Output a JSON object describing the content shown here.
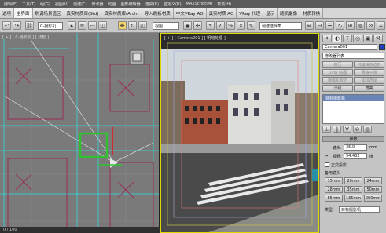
{
  "menubar": {
    "items": [
      "编辑(E)",
      "工具(T)",
      "组(G)",
      "视图(V)",
      "创建(C)",
      "修改器",
      "动画",
      "图形编辑器",
      "渲染(R)",
      "自定义(U)",
      "MAXScript(M)",
      "帮助(H)"
    ]
  },
  "tabs": [
    {
      "label": "选项",
      "active": false
    },
    {
      "label": "主界面",
      "active": true
    },
    {
      "label": "刷调场景值区",
      "active": false
    },
    {
      "label": "真实材质库(Std)",
      "active": false
    },
    {
      "label": "真实材质库(Arch)",
      "active": false
    },
    {
      "label": "导入刷拆材质",
      "active": false
    },
    {
      "label": "中文VRay AO",
      "active": false
    },
    {
      "label": "真实材质 AO",
      "active": false
    },
    {
      "label": "VRay 代理",
      "active": false
    },
    {
      "label": "显示",
      "active": false
    },
    {
      "label": "随机摄像",
      "active": false
    },
    {
      "label": "材质转换",
      "active": false
    }
  ],
  "toolbar": {
    "selection_filter": "全部",
    "ref_coord": "视图",
    "named_sets": "创建选择集"
  },
  "viewports": {
    "left_label": "[ + ] [ C-摄影机 ] [ 线框 ]",
    "right_label": "[ + ] [ Camera001 ] [ 明暗处理 ]",
    "left_select_value": "C-摄影机"
  },
  "statusbar": {
    "text": "0 / 100"
  },
  "panel": {
    "object_name": "Camera001",
    "modifier_list": "修改器列表",
    "buttons_row1": [
      "挤压",
      "可编辑多边形"
    ],
    "buttons_row2": [
      "UVW 贴图",
      "网格平滑"
    ],
    "buttons_row3": [
      "摄像机校正",
      "体积选择"
    ],
    "buttons_row4": [
      "法线",
      "弯曲"
    ],
    "stack_item": "目标摄影机",
    "params_header": "参数",
    "lens_label": "镜头:",
    "lens_value": "35.0",
    "lens_unit": "mm",
    "fov_label": "视野:",
    "fov_value": "54.432",
    "fov_unit": "度",
    "ortho_label": "正交投影",
    "stock_label": "备用镜头",
    "stock_lenses": [
      "15mm",
      "20mm",
      "24mm",
      "28mm",
      "35mm",
      "50mm",
      "85mm",
      "135mm",
      "200mm"
    ],
    "type_label": "类型:",
    "type_value": "目标摄影机"
  },
  "colors": {
    "viewport_border_active": "#e0d600",
    "wire_cyan": "#3fc6c6",
    "wire_magenta": "#9b2c5a",
    "target_green": "#2fc12f"
  }
}
